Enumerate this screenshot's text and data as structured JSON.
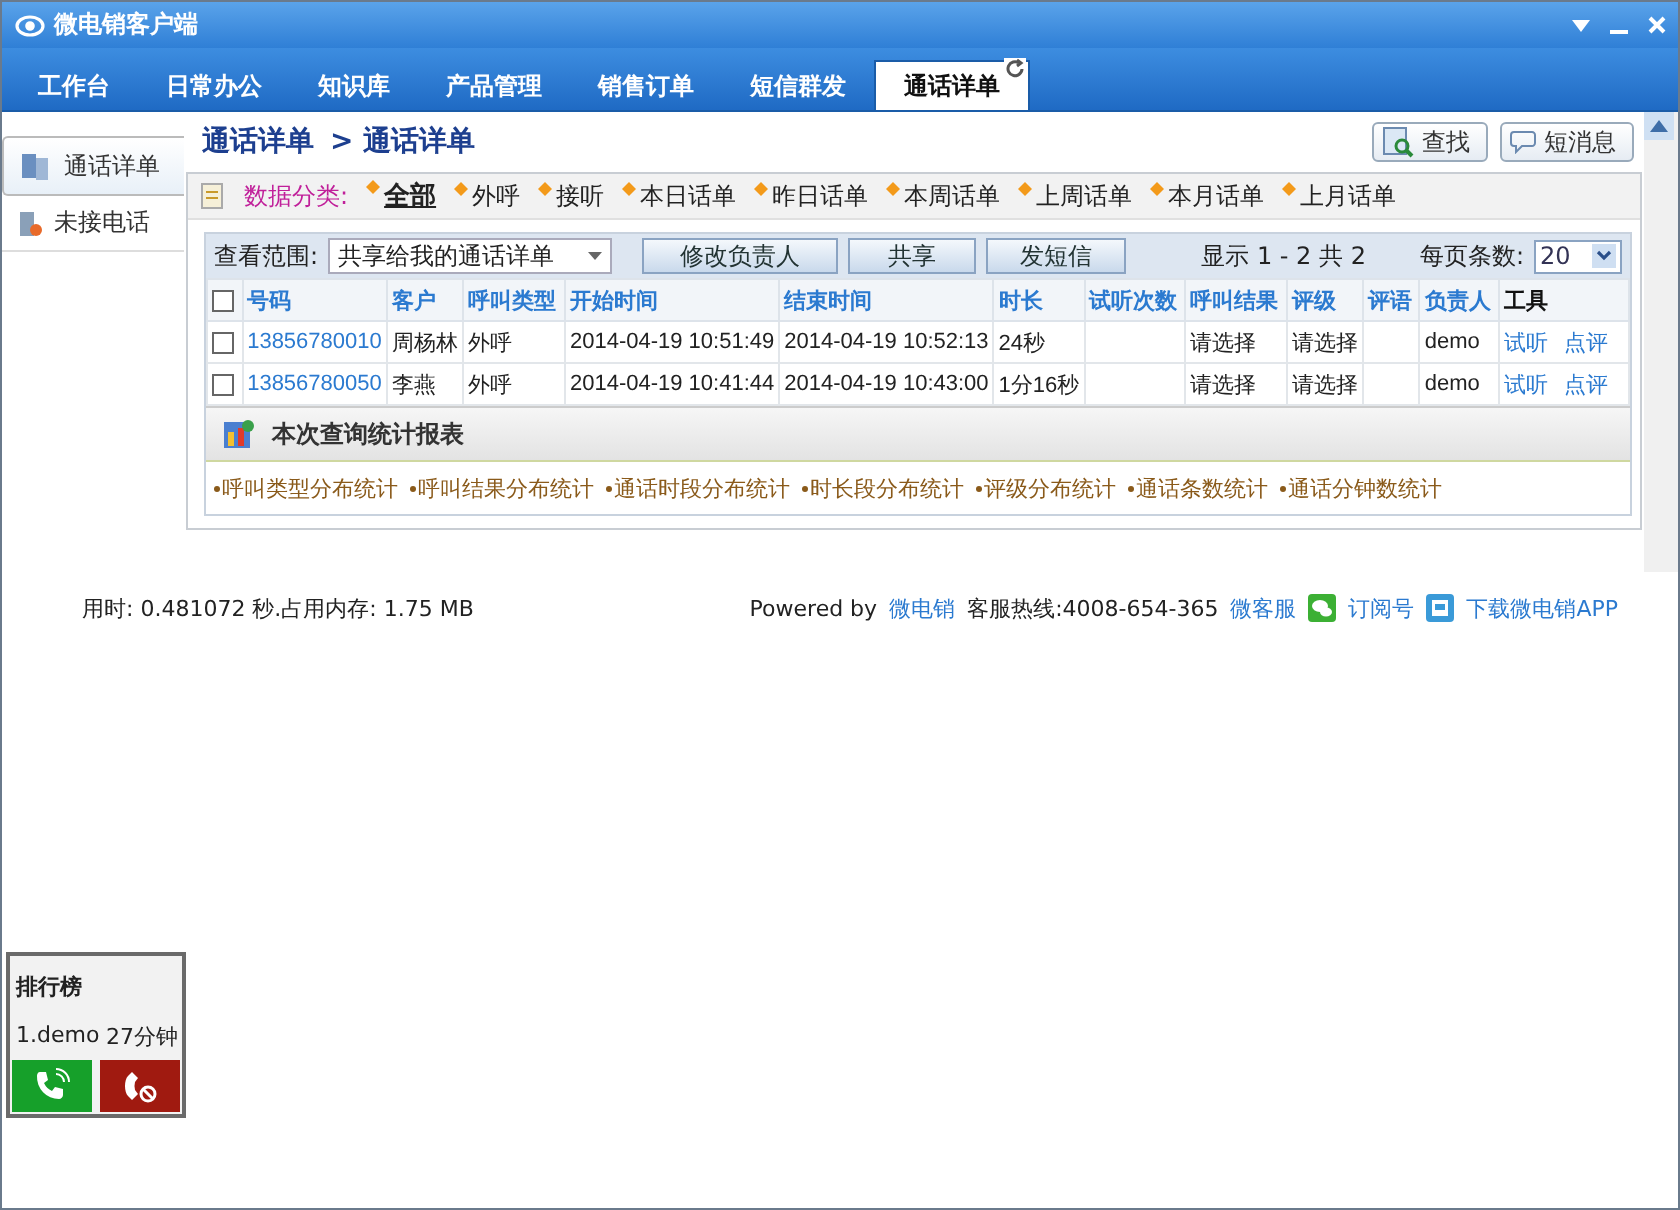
{
  "window": {
    "title": "微电销客户端"
  },
  "tabs": [
    {
      "label": "工作台",
      "selected": false
    },
    {
      "label": "日常办公",
      "selected": false
    },
    {
      "label": "知识库",
      "selected": false
    },
    {
      "label": "产品管理",
      "selected": false
    },
    {
      "label": "销售订单",
      "selected": false
    },
    {
      "label": "短信群发",
      "selected": false
    },
    {
      "label": "通话详单",
      "selected": true
    }
  ],
  "sidebar": {
    "items": [
      {
        "label": "通话详单",
        "selected": true
      },
      {
        "label": "未接电话",
        "selected": false
      }
    ]
  },
  "breadcrumb": [
    "通话详单",
    "> 通话详单"
  ],
  "header_buttons": [
    "查找",
    "短消息"
  ],
  "filter": {
    "label": "数据分类:",
    "items": [
      {
        "label": "全部",
        "selected": true
      },
      {
        "label": "外呼",
        "selected": false
      },
      {
        "label": "接听",
        "selected": false
      },
      {
        "label": "本日话单",
        "selected": false
      },
      {
        "label": "昨日话单",
        "selected": false
      },
      {
        "label": "本周话单",
        "selected": false
      },
      {
        "label": "上周话单",
        "selected": false
      },
      {
        "label": "本月话单",
        "selected": false
      },
      {
        "label": "上月话单",
        "selected": false
      }
    ]
  },
  "toolbar": {
    "scope_label": "查看范围:",
    "scope_value": "共享给我的通话详单",
    "buttons": [
      "修改负责人",
      "共享",
      "发短信"
    ],
    "range": "显示 1 - 2 共 2",
    "page_size_label": "每页条数:",
    "page_size": "20"
  },
  "table": {
    "all_checked": false,
    "columns": [
      "号码",
      "客户",
      "呼叫类型",
      "开始时间",
      "结束时间",
      "时长",
      "试听次数",
      "呼叫结果",
      "评级",
      "评语",
      "负责人",
      "工具"
    ],
    "rows": [
      {
        "checked": false,
        "cells": [
          "13856780010",
          "周杨林",
          "外呼",
          "2014-04-19 10:51:49",
          "2014-04-19 10:52:13",
          "24秒",
          "",
          "请选择",
          "请选择",
          "",
          "demo"
        ],
        "tools": [
          "试听",
          "点评"
        ]
      },
      {
        "checked": false,
        "cells": [
          "13856780050",
          "李燕",
          "外呼",
          "2014-04-19 10:41:44",
          "2014-04-19 10:43:00",
          "1分16秒",
          "",
          "请选择",
          "请选择",
          "",
          "demo"
        ],
        "tools": [
          "试听",
          "点评"
        ]
      }
    ]
  },
  "report": {
    "title": "本次查询统计报表",
    "links": [
      "呼叫类型分布统计",
      "呼叫结果分布统计",
      "通话时段分布统计",
      "时长段分布统计",
      "评级分布统计",
      "通话条数统计",
      "通话分钟数统计"
    ]
  },
  "status": {
    "timing": "用时: 0.481072 秒.占用内存: 1.75 MB",
    "powered": "Powered by",
    "brand": "微电销",
    "hotline": "客服热线:4008-654-365",
    "links": [
      "微客服",
      "订阅号",
      "下载微电销APP"
    ]
  },
  "ranking": {
    "title": "排行榜",
    "entries": [
      {
        "name": "1.demo",
        "value": "27分钟"
      }
    ]
  }
}
